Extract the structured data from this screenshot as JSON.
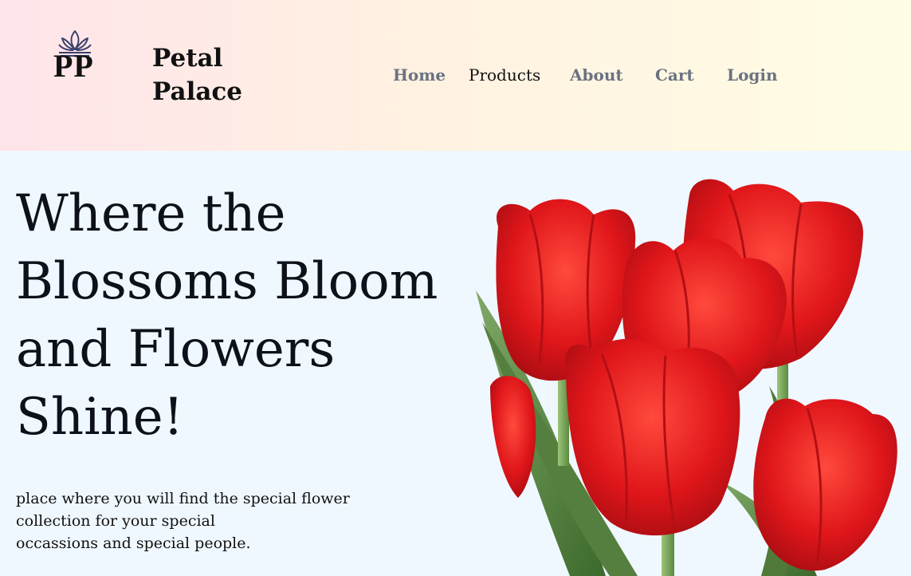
{
  "brand": {
    "logo_letters": "PP",
    "name_line1": "Petal",
    "name_line2": "Palace"
  },
  "nav": {
    "items": [
      {
        "label": "Home",
        "active": false
      },
      {
        "label": "Products",
        "active": true
      },
      {
        "label": "About",
        "active": false
      },
      {
        "label": "Cart",
        "active": false
      },
      {
        "label": "Login",
        "active": false
      }
    ]
  },
  "hero": {
    "title": "Where the Blossoms Bloom and Flowers Shine!",
    "text_lines": [
      "place where you will find the special flower",
      "collection for your special",
      "occassions and special people."
    ]
  },
  "icons": {
    "logo": "crown-icon",
    "hero_image": "red-tulips-image"
  },
  "colors": {
    "nav_inactive": "#6b7280",
    "nav_active": "#111111",
    "page_background": "#f0f8ff",
    "tulip_red": "#e11d1d",
    "leaf_green": "#4f7a3a"
  }
}
